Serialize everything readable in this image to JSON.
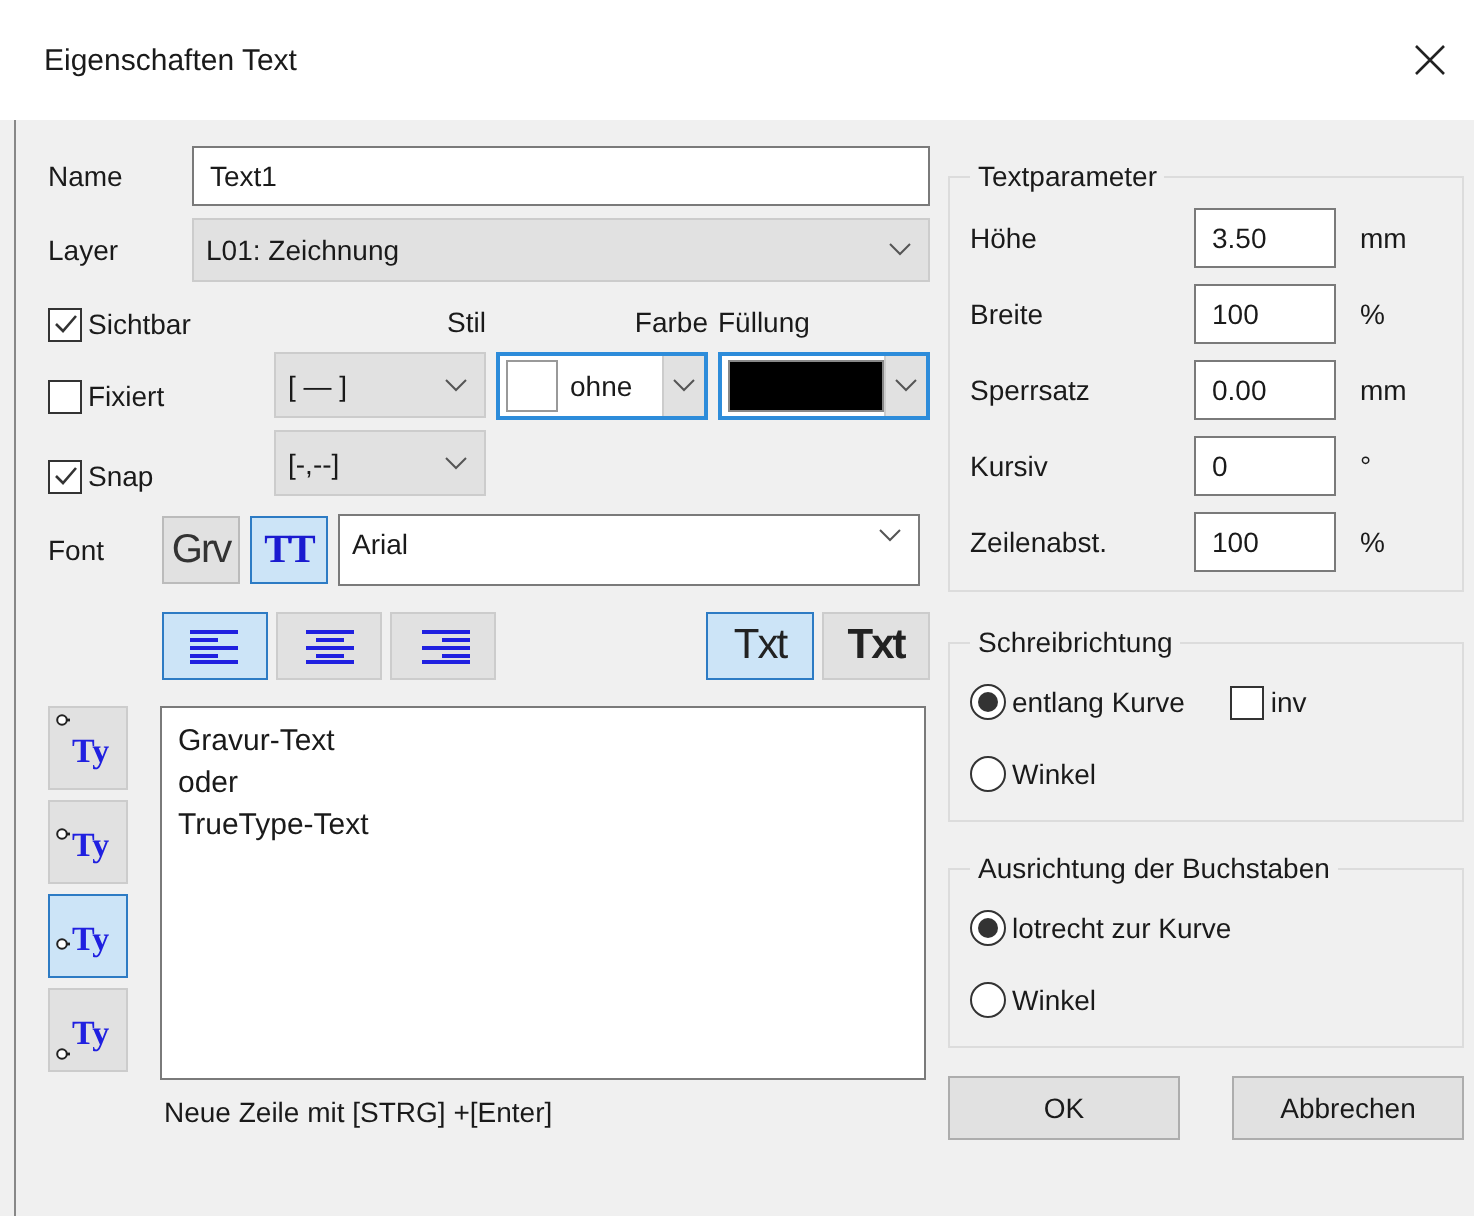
{
  "window": {
    "title": "Eigenschaften Text"
  },
  "name_field": {
    "label": "Name",
    "value": "Text1"
  },
  "layer": {
    "label": "Layer",
    "value": "L01: Zeichnung"
  },
  "flags": [
    {
      "label": "Sichtbar",
      "checked": true
    },
    {
      "label": "Fixiert",
      "checked": false
    },
    {
      "label": "Snap",
      "checked": true
    }
  ],
  "style": {
    "header": "Stil",
    "dropdowns": [
      "[ — ]",
      "[-,--]"
    ]
  },
  "color": {
    "header": "Farbe",
    "value": "ohne",
    "color": "#ffffff"
  },
  "fill": {
    "header": "Füllung",
    "color": "#000000"
  },
  "font": {
    "label": "Font",
    "value": "Arial",
    "modes": [
      {
        "label": "Grv",
        "kind": "engrave",
        "selected": false
      },
      {
        "label": "TT",
        "kind": "truetype",
        "selected": true
      }
    ]
  },
  "alignment": [
    {
      "kind": "left",
      "selected": true
    },
    {
      "kind": "center",
      "selected": false
    },
    {
      "kind": "right",
      "selected": false
    }
  ],
  "weight": [
    {
      "label": "Txt",
      "kind": "normal",
      "selected": true
    },
    {
      "label": "Txt",
      "kind": "bold",
      "selected": false
    }
  ],
  "anchor": [
    {
      "label": "Ty",
      "kind": "top",
      "selected": false
    },
    {
      "label": "Ty",
      "kind": "middle",
      "selected": false
    },
    {
      "label": "Ty",
      "kind": "baseline",
      "selected": true
    },
    {
      "label": "Ty",
      "kind": "bottom",
      "selected": false
    }
  ],
  "text_area": {
    "value": "Gravur-Text\noder\nTrueType-Text"
  },
  "hint": "Neue Zeile mit [STRG] +[Enter]",
  "text_parameters": {
    "title": "Textparameter",
    "rows": [
      {
        "label": "Höhe",
        "value": "3.50",
        "unit": "mm"
      },
      {
        "label": "Breite",
        "value": "100",
        "unit": "%"
      },
      {
        "label": "Sperrsatz",
        "value": "0.00",
        "unit": "mm"
      },
      {
        "label": "Kursiv",
        "value": "0",
        "unit": "°"
      },
      {
        "label": "Zeilenabst.",
        "value": "100",
        "unit": "%"
      }
    ]
  },
  "writing_direction": {
    "title": "Schreibrichtung",
    "options": [
      {
        "label": "entlang Kurve",
        "selected": true
      },
      {
        "label": "Winkel",
        "selected": false
      }
    ],
    "invert": {
      "label": "inv",
      "checked": false
    }
  },
  "letter_orientation": {
    "title": "Ausrichtung der Buchstaben",
    "options": [
      {
        "label": "lotrecht zur Kurve",
        "selected": true
      },
      {
        "label": "Winkel",
        "selected": false
      }
    ]
  },
  "buttons": [
    "OK",
    "Abbrechen"
  ]
}
